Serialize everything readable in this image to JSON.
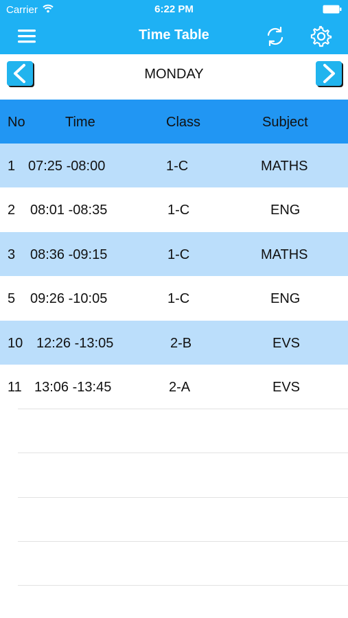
{
  "status": {
    "carrier": "Carrier",
    "time": "6:22 PM"
  },
  "header": {
    "title": "Time Table"
  },
  "day": {
    "name": "MONDAY"
  },
  "table": {
    "columns": [
      "No",
      "Time",
      "Class",
      "Subject"
    ],
    "rows": [
      {
        "no": "1",
        "time": "07:25 -08:00",
        "class": "1-C",
        "subject": "MATHS"
      },
      {
        "no": "2",
        "time": "08:01 -08:35",
        "class": "1-C",
        "subject": "ENG"
      },
      {
        "no": "3",
        "time": "08:36 -09:15",
        "class": "1-C",
        "subject": "MATHS"
      },
      {
        "no": "5",
        "time": "09:26 -10:05",
        "class": "1-C",
        "subject": "ENG"
      },
      {
        "no": "10",
        "time": "12:26 -13:05",
        "class": "2-B",
        "subject": "EVS"
      },
      {
        "no": "11",
        "time": "13:06 -13:45",
        "class": "2-A",
        "subject": "EVS"
      }
    ]
  },
  "colors": {
    "bar": "#1eb1f4",
    "header": "#2196f3",
    "shaded_row": "#bbdefb"
  },
  "icons": [
    "wifi-icon",
    "battery-icon",
    "menu-icon",
    "refresh-icon",
    "settings-icon",
    "chevron-left-icon",
    "chevron-right-icon"
  ]
}
